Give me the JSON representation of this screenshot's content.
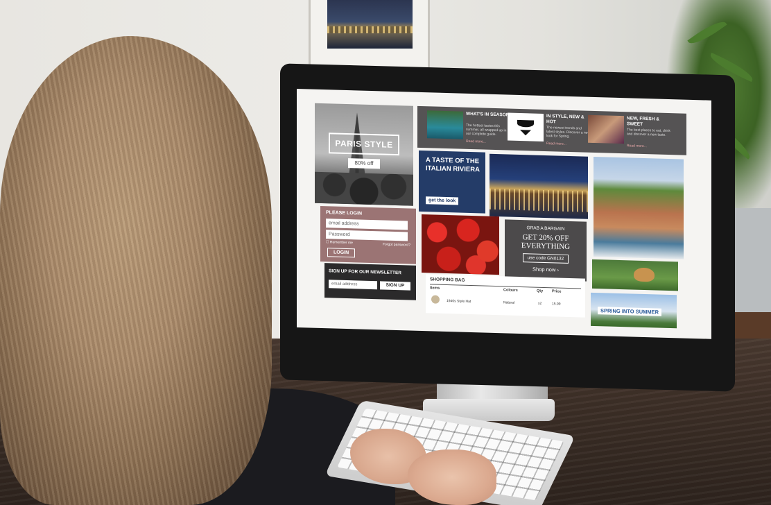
{
  "screen": {
    "paris": {
      "title": "PARIS STYLE",
      "offer": "80% off"
    },
    "strip": [
      {
        "title": "WHAT'S IN SEASON",
        "text": "The hottest tastes this summer, all wrapped up in our complete guide.",
        "link": "Read more..."
      },
      {
        "title": "IN STYLE, NEW & HOT",
        "text": "The newest trends and latest styles. Discover a new look for Spring.",
        "link": "Read more..."
      },
      {
        "title": "NEW, FRESH & SWEET",
        "text": "The best places to eat, drink and discover a new taste.",
        "link": "Read more..."
      }
    ],
    "taste": {
      "title": "A TASTE OF THE ITALIAN RIVIERA",
      "button": "get the look"
    },
    "login": {
      "title": "PLEASE LOGIN",
      "email_placeholder": "email address",
      "password_placeholder": "Password",
      "remember": "Remember me",
      "forgot": "Forgot password?",
      "button": "LOGIN"
    },
    "newsletter": {
      "title": "SIGN UP FOR OUR NEWSLETTER",
      "email_placeholder": "email address",
      "button": "SIGN UP"
    },
    "bargain": {
      "kicker": "GRAB A BARGAIN",
      "headline": "GET 20% OFF EVERYTHING",
      "code": "use code GN0132",
      "cta": "Shop now ›"
    },
    "bag": {
      "title": "SHOPPING BAG",
      "headers": {
        "items": "Items",
        "colours": "Colours",
        "qty": "Qty",
        "price": "Price"
      },
      "row": {
        "item": "1940s Style Hat",
        "colour": "Natural",
        "qty": "x2",
        "price": "15.99"
      }
    },
    "spring": {
      "label": "SPRING INTO SUMMER"
    }
  },
  "colors": {
    "screen_bg": "#f5f4f2",
    "strip_bg": "#555354",
    "taste_bg": "#243c68",
    "login_bg": "#9b7474",
    "newsletter_bg": "#2b2a2b",
    "bargain_bg": "#4c4a4b",
    "desk": "#3d2f27",
    "hair": "#a8896a"
  }
}
